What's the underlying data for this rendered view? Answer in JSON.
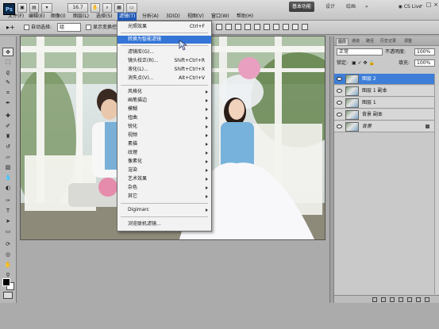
{
  "menubar": {
    "logo": "Ps",
    "zoom": "16.7",
    "items": [
      "文件(F)",
      "编辑(E)",
      "图像(I)",
      "图层(L)",
      "选择(S)",
      "滤镜(T)",
      "分析(A)",
      "3D(D)",
      "视图(V)",
      "窗口(W)",
      "帮助(H)"
    ],
    "workspace_tabs": [
      "基本功能",
      "设计",
      "绘画",
      "»"
    ],
    "cs_live": "CS Live",
    "window_buttons": [
      "–",
      "□",
      "×"
    ]
  },
  "options": {
    "auto_select_label": "自动选择:",
    "auto_select_value": "组",
    "show_transform_label": "显示变换控"
  },
  "tools": [
    "move-tool",
    "marquee-tool",
    "lasso-tool",
    "quick-select-tool",
    "crop-tool",
    "eyedropper-tool",
    "spot-heal-tool",
    "brush-tool",
    "clone-stamp-tool",
    "history-brush-tool",
    "eraser-tool",
    "gradient-tool",
    "blur-tool",
    "dodge-tool",
    "pen-tool",
    "type-tool",
    "path-select-tool",
    "rectangle-tool",
    "3d-rotate-tool",
    "3d-orbit-tool",
    "hand-tool",
    "zoom-tool"
  ],
  "filter_menu": {
    "items": [
      {
        "label": "光照效果",
        "shortcut": "Ctrl+F"
      },
      {
        "label": "转换为智能滤镜",
        "highlighted": true
      },
      {
        "label": "滤镜库(G)..."
      },
      {
        "label": "镜头校正(R)...",
        "shortcut": "Shift+Ctrl+R"
      },
      {
        "label": "液化(L)...",
        "shortcut": "Shift+Ctrl+X"
      },
      {
        "label": "消失点(V)...",
        "shortcut": "Alt+Ctrl+V"
      },
      {
        "label": "风格化",
        "submenu": true
      },
      {
        "label": "画笔描边",
        "submenu": true
      },
      {
        "label": "模糊",
        "submenu": true
      },
      {
        "label": "扭曲",
        "submenu": true
      },
      {
        "label": "锐化",
        "submenu": true
      },
      {
        "label": "视频",
        "submenu": true
      },
      {
        "label": "素描",
        "submenu": true
      },
      {
        "label": "纹理",
        "submenu": true
      },
      {
        "label": "像素化",
        "submenu": true
      },
      {
        "label": "渲染",
        "submenu": true
      },
      {
        "label": "艺术效果",
        "submenu": true
      },
      {
        "label": "杂色",
        "submenu": true
      },
      {
        "label": "其它",
        "submenu": true
      },
      {
        "label": "Digimarc",
        "submenu": true
      },
      {
        "label": "浏览联机滤镜..."
      }
    ]
  },
  "layers_panel": {
    "tabs": [
      "图层",
      "通道",
      "路径",
      "历史记录",
      "调整"
    ],
    "blend_mode": "正常",
    "opacity_label": "不透明度:",
    "opacity": "100%",
    "lock_label": "锁定:",
    "fill_label": "填充:",
    "fill": "100%",
    "layers": [
      {
        "name": "图层 2",
        "active": true
      },
      {
        "name": "图层 1 副本",
        "active": false
      },
      {
        "name": "图层 1",
        "active": false
      },
      {
        "name": "背景 副本",
        "active": false
      },
      {
        "name": "背景",
        "active": false,
        "locked": true
      }
    ]
  },
  "colors": {
    "menu_highlight": "#3475d6",
    "layer_selected": "#3d7ed8",
    "workspace_active": "#4a4a4a"
  }
}
